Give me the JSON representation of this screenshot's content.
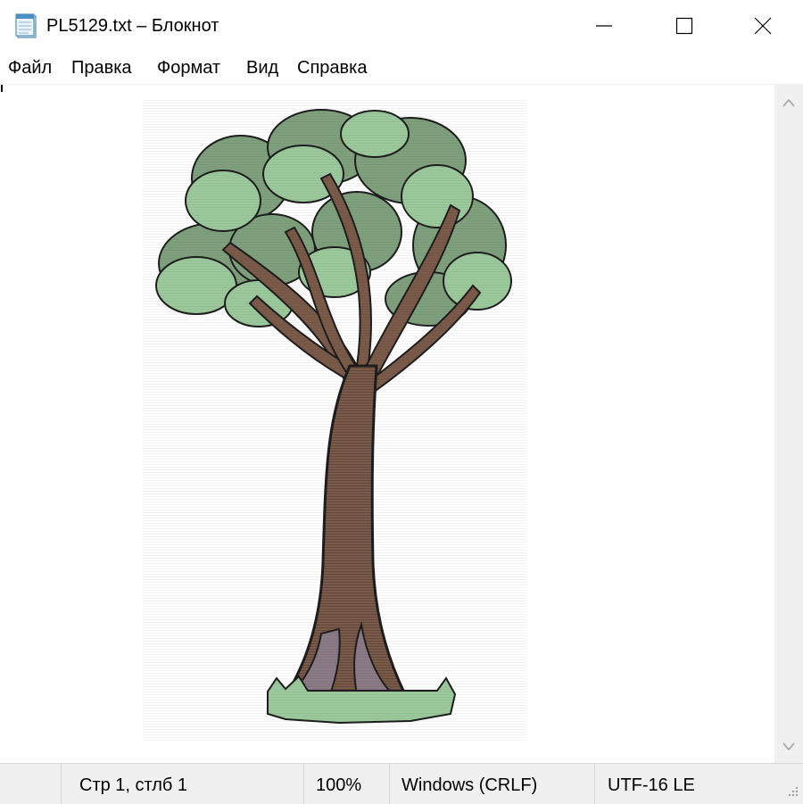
{
  "window": {
    "title": "PL5129.txt – Блокнот"
  },
  "menu": {
    "items": [
      "Файл",
      "Правка",
      "Формат",
      "Вид",
      "Справка"
    ]
  },
  "editor": {
    "content_image": "tree-ascii-art"
  },
  "statusbar": {
    "position": "Стр 1, стлб 1",
    "zoom": "100%",
    "line_endings": "Windows (CRLF)",
    "encoding": "UTF-16 LE"
  },
  "colors": {
    "foliage_dark": "#7fa07c",
    "foliage_light": "#9cc99c",
    "trunk": "#7a5a49",
    "outline": "#1e1e1e",
    "chrome": "#f0f0f0"
  }
}
